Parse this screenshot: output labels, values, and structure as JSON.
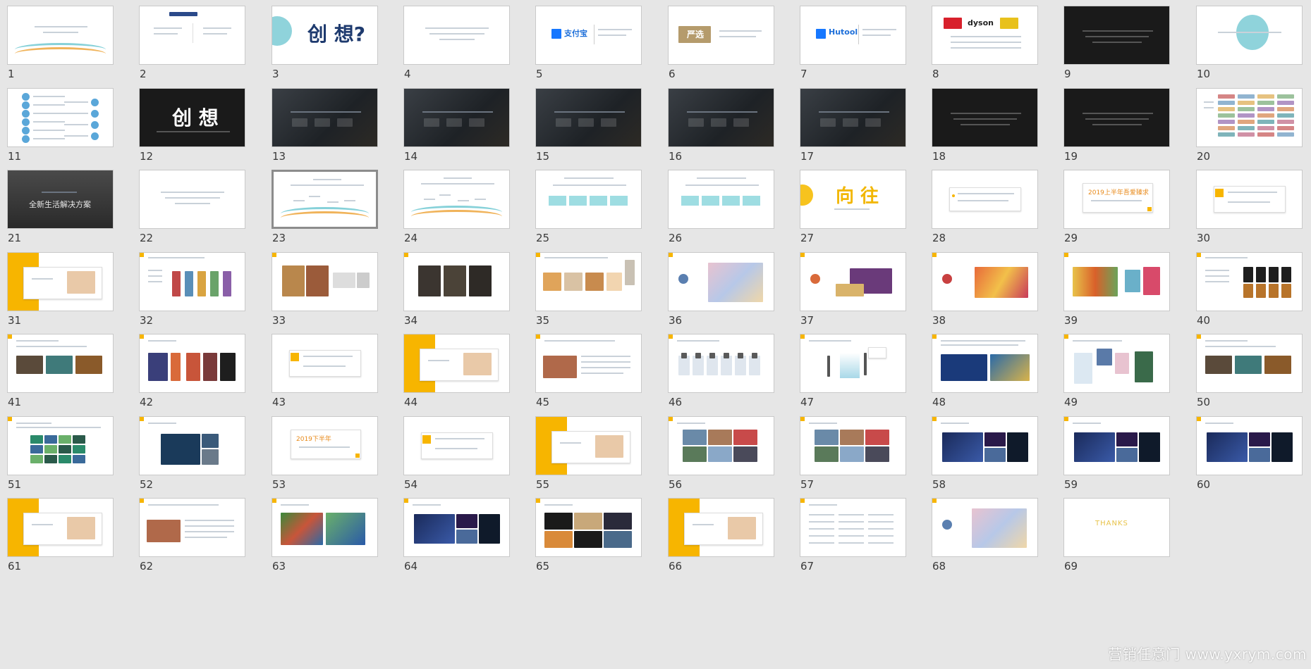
{
  "selected_slide": "23",
  "slides": [
    {
      "n": "1",
      "kind": "title-wave"
    },
    {
      "n": "2",
      "kind": "two-col"
    },
    {
      "n": "3",
      "kind": "big-text",
      "text": "创 想?"
    },
    {
      "n": "4",
      "kind": "sparse-text"
    },
    {
      "n": "5",
      "kind": "brand",
      "text": "支付宝"
    },
    {
      "n": "6",
      "kind": "brand-box",
      "text": "严选"
    },
    {
      "n": "7",
      "kind": "brand",
      "text": "Hutool"
    },
    {
      "n": "8",
      "kind": "logos",
      "text": "dyson"
    },
    {
      "n": "9",
      "kind": "dark-text"
    },
    {
      "n": "10",
      "kind": "circle"
    },
    {
      "n": "11",
      "kind": "bubbles"
    },
    {
      "n": "12",
      "kind": "dark-big",
      "text": "创 想"
    },
    {
      "n": "13",
      "kind": "photo-title"
    },
    {
      "n": "14",
      "kind": "photo-title"
    },
    {
      "n": "15",
      "kind": "photo-title"
    },
    {
      "n": "16",
      "kind": "photo-title"
    },
    {
      "n": "17",
      "kind": "photo-title"
    },
    {
      "n": "18",
      "kind": "dark-text"
    },
    {
      "n": "19",
      "kind": "dark-text"
    },
    {
      "n": "20",
      "kind": "table-colors"
    },
    {
      "n": "21",
      "kind": "photo-caption",
      "text": "全新生活解决方案"
    },
    {
      "n": "22",
      "kind": "sparse-text"
    },
    {
      "n": "23",
      "kind": "wave-labels"
    },
    {
      "n": "24",
      "kind": "wave-labels"
    },
    {
      "n": "25",
      "kind": "boxes"
    },
    {
      "n": "26",
      "kind": "boxes"
    },
    {
      "n": "27",
      "kind": "big-yellow",
      "text": "向 往"
    },
    {
      "n": "28",
      "kind": "frame"
    },
    {
      "n": "29",
      "kind": "frame-orange",
      "text": "2019上半年吾爱臻求"
    },
    {
      "n": "30",
      "kind": "frame-num"
    },
    {
      "n": "31",
      "kind": "yellow-side"
    },
    {
      "n": "32",
      "kind": "figures"
    },
    {
      "n": "33",
      "kind": "img-grid"
    },
    {
      "n": "34",
      "kind": "img-grid-dark"
    },
    {
      "n": "35",
      "kind": "food"
    },
    {
      "n": "36",
      "kind": "illus"
    },
    {
      "n": "37",
      "kind": "illus-purple"
    },
    {
      "n": "38",
      "kind": "illus-face"
    },
    {
      "n": "39",
      "kind": "illus-color"
    },
    {
      "n": "40",
      "kind": "cards"
    },
    {
      "n": "41",
      "kind": "photos3"
    },
    {
      "n": "42",
      "kind": "posters"
    },
    {
      "n": "43",
      "kind": "frame-num"
    },
    {
      "n": "44",
      "kind": "yellow-side"
    },
    {
      "n": "45",
      "kind": "photo-text"
    },
    {
      "n": "46",
      "kind": "figures-white"
    },
    {
      "n": "47",
      "kind": "diagram"
    },
    {
      "n": "48",
      "kind": "blue-photos"
    },
    {
      "n": "49",
      "kind": "collage"
    },
    {
      "n": "50",
      "kind": "photos3"
    },
    {
      "n": "51",
      "kind": "grid-green"
    },
    {
      "n": "52",
      "kind": "photo-wide"
    },
    {
      "n": "53",
      "kind": "frame-orange",
      "text": "2019下半年"
    },
    {
      "n": "54",
      "kind": "frame-num"
    },
    {
      "n": "55",
      "kind": "yellow-side"
    },
    {
      "n": "56",
      "kind": "photos-grid"
    },
    {
      "n": "57",
      "kind": "photos-grid"
    },
    {
      "n": "58",
      "kind": "night-photos"
    },
    {
      "n": "59",
      "kind": "night-photos"
    },
    {
      "n": "60",
      "kind": "night-photos"
    },
    {
      "n": "61",
      "kind": "yellow-side"
    },
    {
      "n": "62",
      "kind": "photo-text"
    },
    {
      "n": "63",
      "kind": "sport"
    },
    {
      "n": "64",
      "kind": "night-photos"
    },
    {
      "n": "65",
      "kind": "collage-dark"
    },
    {
      "n": "66",
      "kind": "yellow-side"
    },
    {
      "n": "67",
      "kind": "table-text"
    },
    {
      "n": "68",
      "kind": "illus"
    },
    {
      "n": "69",
      "kind": "thanks",
      "text": "THANKS"
    }
  ],
  "watermark": "营销任意门 www.yxrym.com"
}
